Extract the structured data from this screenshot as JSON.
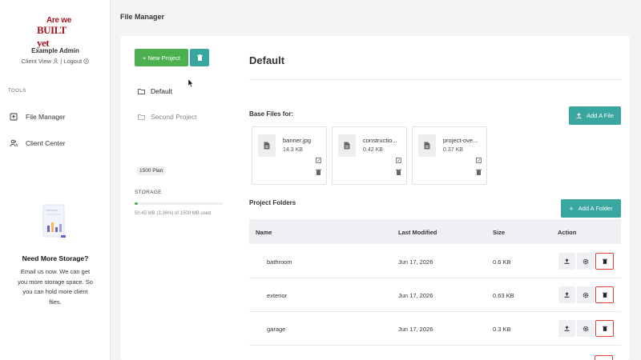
{
  "brand": {
    "logo_line1": "Are we",
    "logo_line2": "BUILT yet"
  },
  "user": {
    "name": "Example Admin",
    "client_view": "Client View",
    "separator": " | ",
    "logout": "Logout"
  },
  "sidebar": {
    "tools_label": "TOOLS",
    "items": [
      {
        "label": "File Manager",
        "icon": "file-upload-icon"
      },
      {
        "label": "Client Center",
        "icon": "users-icon"
      }
    ],
    "promo_title": "Need More Storage?",
    "promo_text": "Email us now. We can get you more storage space. So you can hold more client files."
  },
  "header": {
    "title": "File Manager"
  },
  "projects": {
    "new_button": "+ New Project",
    "items": [
      {
        "label": "Default",
        "active": true
      },
      {
        "label": "Second Project",
        "active": false
      }
    ],
    "plan": "1500 Plan",
    "storage_label": "STORAGE",
    "storage_fraction": 0.0336,
    "storage_usage": "50.45 MB (3.36%) of 1500 MB used"
  },
  "main": {
    "title": "Default",
    "base_files_label": "Base Files for:",
    "add_file_button": "Add A File",
    "files": [
      {
        "name": "banner.jpg",
        "size": "14.3 KB"
      },
      {
        "name": "constructio...",
        "size": "0.42 KB"
      },
      {
        "name": "project-ove...",
        "size": "0.37 KB"
      }
    ],
    "folders_label": "Project Folders",
    "add_folder_button": "Add A Folder",
    "columns": [
      "Name",
      "Last Modified",
      "Size",
      "Action"
    ],
    "rows": [
      {
        "name": "bathroom",
        "modified": "Jun 17, 2026",
        "size": "0.6 KB"
      },
      {
        "name": "exterior",
        "modified": "Jun 17, 2026",
        "size": "0.63 KB"
      },
      {
        "name": "garage",
        "modified": "Jun 17, 2026",
        "size": "0.3 KB"
      }
    ]
  },
  "colors": {
    "green": "#4caf50",
    "teal": "#3aa6a0",
    "brand_red": "#a31621",
    "danger": "#e53935"
  }
}
